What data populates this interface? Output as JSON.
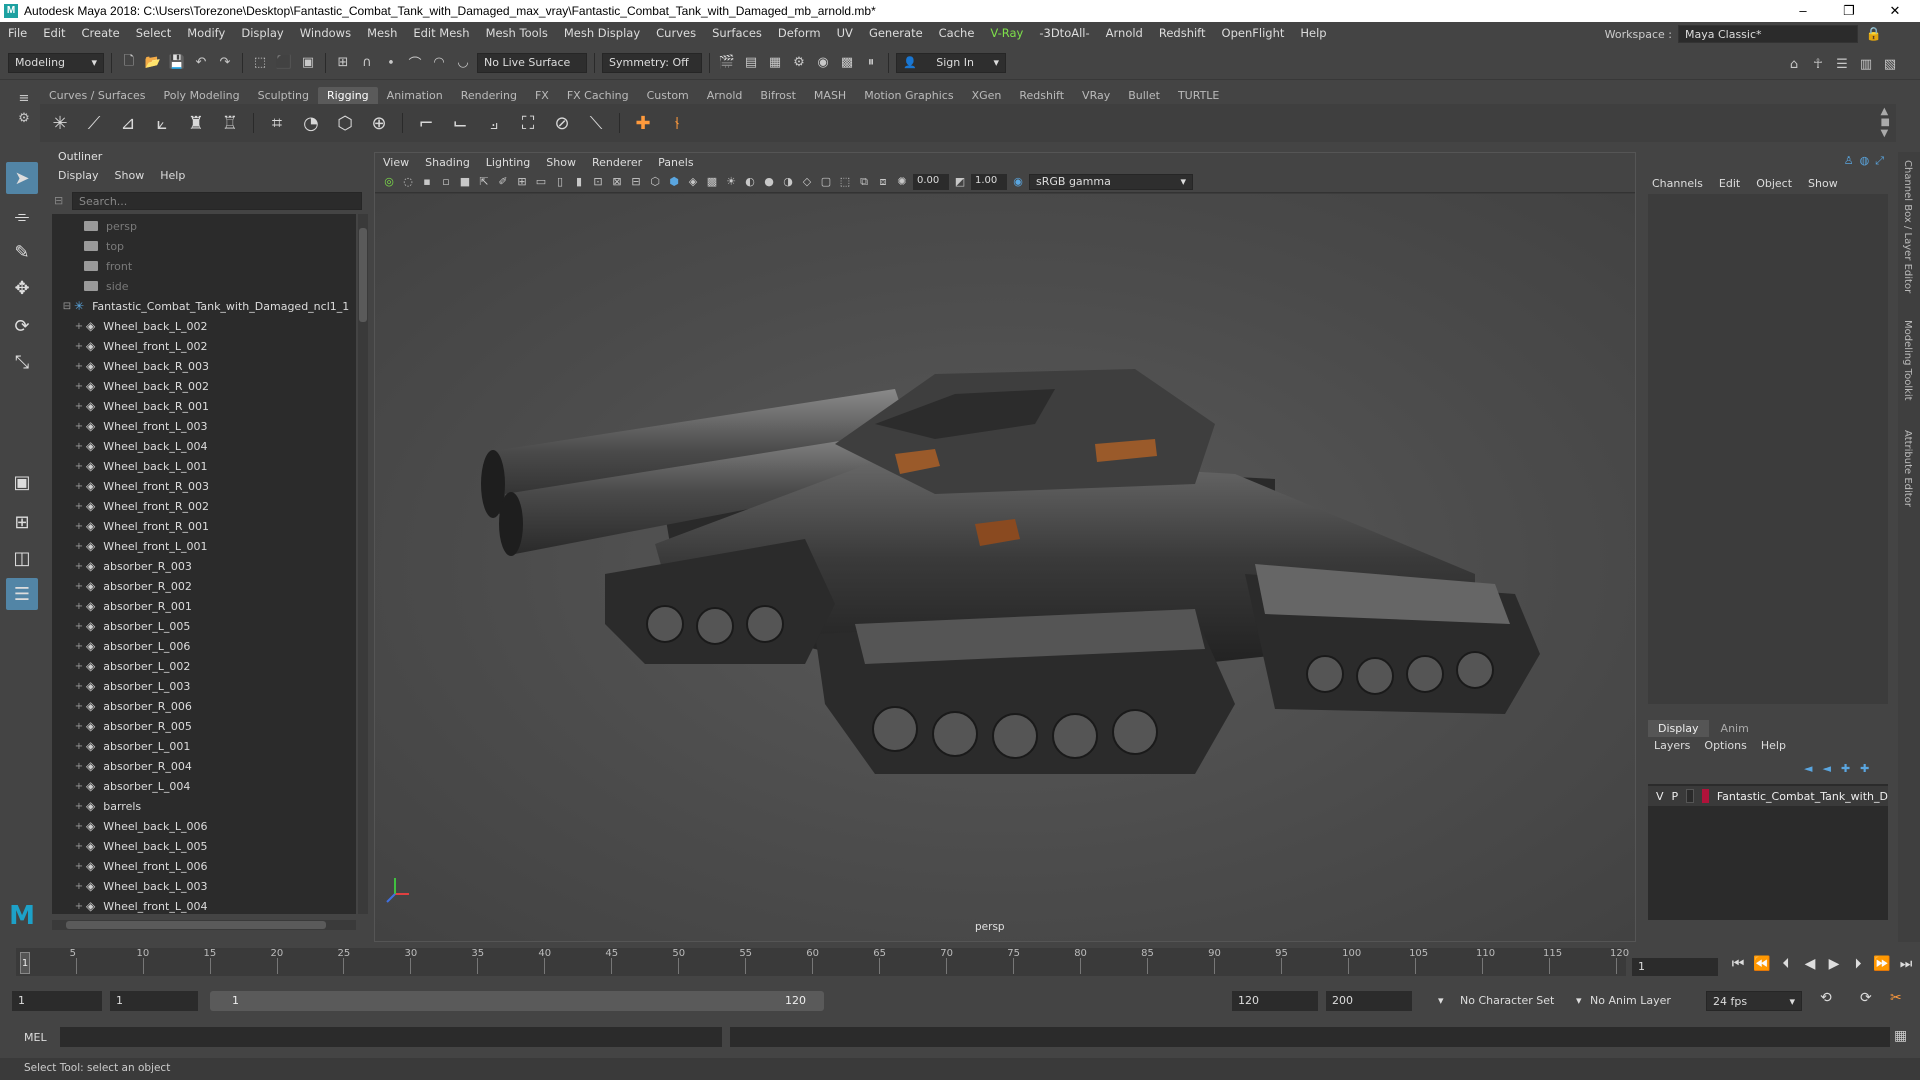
{
  "window": {
    "title": "Autodesk Maya 2018: C:\\Users\\Torezone\\Desktop\\Fantastic_Combat_Tank_with_Damaged_max_vray\\Fantastic_Combat_Tank_with_Damaged_mb_arnold.mb*",
    "logo": "M"
  },
  "menus": [
    "File",
    "Edit",
    "Create",
    "Select",
    "Modify",
    "Display",
    "Windows",
    "Mesh",
    "Edit Mesh",
    "Mesh Tools",
    "Mesh Display",
    "Curves",
    "Surfaces",
    "Deform",
    "UV",
    "Generate",
    "Cache",
    "-3DtoAll-",
    "Arnold",
    "Redshift",
    "OpenFlight",
    "Help"
  ],
  "vray_menu": "V-Ray",
  "workspace": {
    "label": "Workspace :",
    "value": "Maya Classic*"
  },
  "statusline": {
    "mode": "Modeling",
    "live_surface": "No Live Surface",
    "symmetry": "Symmetry: Off",
    "sign_in": "Sign In"
  },
  "shelf_tabs": [
    "Curves / Surfaces",
    "Poly Modeling",
    "Sculpting",
    "Rigging",
    "Animation",
    "Rendering",
    "FX",
    "FX Caching",
    "Custom",
    "Arnold",
    "Bifrost",
    "MASH",
    "Motion Graphics",
    "XGen",
    "Redshift",
    "VRay",
    "Bullet",
    "TURTLE"
  ],
  "shelf_active": "Rigging",
  "outliner": {
    "title": "Outliner",
    "menu": [
      "Display",
      "Show",
      "Help"
    ],
    "search_placeholder": "Search...",
    "cameras": [
      "persp",
      "top",
      "front",
      "side"
    ],
    "root": "Fantastic_Combat_Tank_with_Damaged_ncl1_1",
    "items": [
      "Wheel_back_L_002",
      "Wheel_front_L_002",
      "Wheel_back_R_003",
      "Wheel_back_R_002",
      "Wheel_back_R_001",
      "Wheel_front_L_003",
      "Wheel_back_L_004",
      "Wheel_back_L_001",
      "Wheel_front_R_003",
      "Wheel_front_R_002",
      "Wheel_front_R_001",
      "Wheel_front_L_001",
      "absorber_R_003",
      "absorber_R_002",
      "absorber_R_001",
      "absorber_L_005",
      "absorber_L_006",
      "absorber_L_002",
      "absorber_L_003",
      "absorber_R_006",
      "absorber_R_005",
      "absorber_L_001",
      "absorber_R_004",
      "absorber_L_004",
      "barrels",
      "Wheel_back_L_006",
      "Wheel_back_L_005",
      "Wheel_front_L_006",
      "Wheel_back_L_003",
      "Wheel_front_L_004"
    ]
  },
  "viewport": {
    "menu": [
      "View",
      "Shading",
      "Lighting",
      "Show",
      "Renderer",
      "Panels"
    ],
    "exposure": "0.00",
    "gamma": "1.00",
    "color_space": "sRGB gamma",
    "camera_label": "persp"
  },
  "channelbox": {
    "menu": [
      "Channels",
      "Edit",
      "Object",
      "Show"
    ],
    "layer_tabs": [
      "Display",
      "Anim"
    ],
    "layer_menu": [
      "Layers",
      "Options",
      "Help"
    ],
    "layer": {
      "v": "V",
      "p": "P",
      "name": "Fantastic_Combat_Tank_with_D",
      "color": "#b0123a"
    }
  },
  "side_tabs": [
    "Channel Box / Layer Editor",
    "Modeling Toolkit",
    "Attribute Editor"
  ],
  "timeline": {
    "ticks": [
      5,
      10,
      15,
      20,
      25,
      30,
      35,
      40,
      45,
      50,
      55,
      60,
      65,
      70,
      75,
      80,
      85,
      90,
      95,
      100,
      105,
      110,
      115,
      120
    ],
    "playhead": "1",
    "current_frame": "1"
  },
  "range": {
    "start": "1",
    "playback_start": "1",
    "slider_start": "1",
    "slider_end": "120",
    "playback_end": "120",
    "end": "200",
    "character_set": "No Character Set",
    "anim_layer": "No Anim Layer",
    "fps": "24 fps"
  },
  "cmdline": {
    "label": "MEL"
  },
  "helpline": "Select Tool: select an object"
}
